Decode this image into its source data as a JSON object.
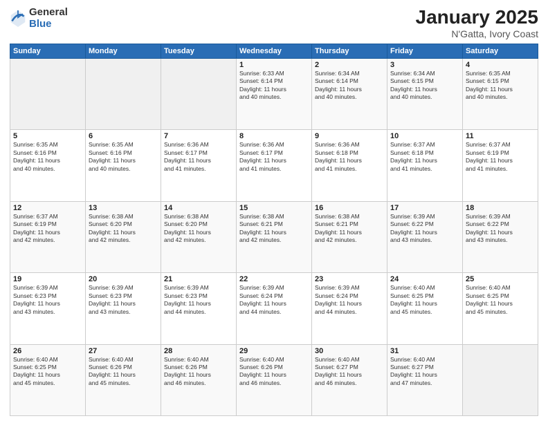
{
  "logo": {
    "general": "General",
    "blue": "Blue"
  },
  "title": {
    "month": "January 2025",
    "location": "N'Gatta, Ivory Coast"
  },
  "weekdays": [
    "Sunday",
    "Monday",
    "Tuesday",
    "Wednesday",
    "Thursday",
    "Friday",
    "Saturday"
  ],
  "weeks": [
    [
      {
        "day": "",
        "info": ""
      },
      {
        "day": "",
        "info": ""
      },
      {
        "day": "",
        "info": ""
      },
      {
        "day": "1",
        "info": "Sunrise: 6:33 AM\nSunset: 6:14 PM\nDaylight: 11 hours\nand 40 minutes."
      },
      {
        "day": "2",
        "info": "Sunrise: 6:34 AM\nSunset: 6:14 PM\nDaylight: 11 hours\nand 40 minutes."
      },
      {
        "day": "3",
        "info": "Sunrise: 6:34 AM\nSunset: 6:15 PM\nDaylight: 11 hours\nand 40 minutes."
      },
      {
        "day": "4",
        "info": "Sunrise: 6:35 AM\nSunset: 6:15 PM\nDaylight: 11 hours\nand 40 minutes."
      }
    ],
    [
      {
        "day": "5",
        "info": "Sunrise: 6:35 AM\nSunset: 6:16 PM\nDaylight: 11 hours\nand 40 minutes."
      },
      {
        "day": "6",
        "info": "Sunrise: 6:35 AM\nSunset: 6:16 PM\nDaylight: 11 hours\nand 40 minutes."
      },
      {
        "day": "7",
        "info": "Sunrise: 6:36 AM\nSunset: 6:17 PM\nDaylight: 11 hours\nand 41 minutes."
      },
      {
        "day": "8",
        "info": "Sunrise: 6:36 AM\nSunset: 6:17 PM\nDaylight: 11 hours\nand 41 minutes."
      },
      {
        "day": "9",
        "info": "Sunrise: 6:36 AM\nSunset: 6:18 PM\nDaylight: 11 hours\nand 41 minutes."
      },
      {
        "day": "10",
        "info": "Sunrise: 6:37 AM\nSunset: 6:18 PM\nDaylight: 11 hours\nand 41 minutes."
      },
      {
        "day": "11",
        "info": "Sunrise: 6:37 AM\nSunset: 6:19 PM\nDaylight: 11 hours\nand 41 minutes."
      }
    ],
    [
      {
        "day": "12",
        "info": "Sunrise: 6:37 AM\nSunset: 6:19 PM\nDaylight: 11 hours\nand 42 minutes."
      },
      {
        "day": "13",
        "info": "Sunrise: 6:38 AM\nSunset: 6:20 PM\nDaylight: 11 hours\nand 42 minutes."
      },
      {
        "day": "14",
        "info": "Sunrise: 6:38 AM\nSunset: 6:20 PM\nDaylight: 11 hours\nand 42 minutes."
      },
      {
        "day": "15",
        "info": "Sunrise: 6:38 AM\nSunset: 6:21 PM\nDaylight: 11 hours\nand 42 minutes."
      },
      {
        "day": "16",
        "info": "Sunrise: 6:38 AM\nSunset: 6:21 PM\nDaylight: 11 hours\nand 42 minutes."
      },
      {
        "day": "17",
        "info": "Sunrise: 6:39 AM\nSunset: 6:22 PM\nDaylight: 11 hours\nand 43 minutes."
      },
      {
        "day": "18",
        "info": "Sunrise: 6:39 AM\nSunset: 6:22 PM\nDaylight: 11 hours\nand 43 minutes."
      }
    ],
    [
      {
        "day": "19",
        "info": "Sunrise: 6:39 AM\nSunset: 6:23 PM\nDaylight: 11 hours\nand 43 minutes."
      },
      {
        "day": "20",
        "info": "Sunrise: 6:39 AM\nSunset: 6:23 PM\nDaylight: 11 hours\nand 43 minutes."
      },
      {
        "day": "21",
        "info": "Sunrise: 6:39 AM\nSunset: 6:23 PM\nDaylight: 11 hours\nand 44 minutes."
      },
      {
        "day": "22",
        "info": "Sunrise: 6:39 AM\nSunset: 6:24 PM\nDaylight: 11 hours\nand 44 minutes."
      },
      {
        "day": "23",
        "info": "Sunrise: 6:39 AM\nSunset: 6:24 PM\nDaylight: 11 hours\nand 44 minutes."
      },
      {
        "day": "24",
        "info": "Sunrise: 6:40 AM\nSunset: 6:25 PM\nDaylight: 11 hours\nand 45 minutes."
      },
      {
        "day": "25",
        "info": "Sunrise: 6:40 AM\nSunset: 6:25 PM\nDaylight: 11 hours\nand 45 minutes."
      }
    ],
    [
      {
        "day": "26",
        "info": "Sunrise: 6:40 AM\nSunset: 6:25 PM\nDaylight: 11 hours\nand 45 minutes."
      },
      {
        "day": "27",
        "info": "Sunrise: 6:40 AM\nSunset: 6:26 PM\nDaylight: 11 hours\nand 45 minutes."
      },
      {
        "day": "28",
        "info": "Sunrise: 6:40 AM\nSunset: 6:26 PM\nDaylight: 11 hours\nand 46 minutes."
      },
      {
        "day": "29",
        "info": "Sunrise: 6:40 AM\nSunset: 6:26 PM\nDaylight: 11 hours\nand 46 minutes."
      },
      {
        "day": "30",
        "info": "Sunrise: 6:40 AM\nSunset: 6:27 PM\nDaylight: 11 hours\nand 46 minutes."
      },
      {
        "day": "31",
        "info": "Sunrise: 6:40 AM\nSunset: 6:27 PM\nDaylight: 11 hours\nand 47 minutes."
      },
      {
        "day": "",
        "info": ""
      }
    ]
  ]
}
